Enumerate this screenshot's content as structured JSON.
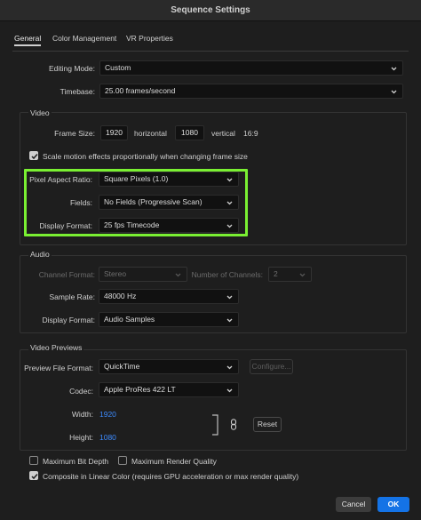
{
  "window": {
    "title": "Sequence Settings"
  },
  "tabs": [
    {
      "label": "General",
      "active": true
    },
    {
      "label": "Color Management",
      "active": false
    },
    {
      "label": "VR Properties",
      "active": false
    }
  ],
  "general": {
    "editing_mode": {
      "label": "Editing Mode:",
      "value": "Custom"
    },
    "timebase": {
      "label": "Timebase:",
      "value": "25.00  frames/second"
    }
  },
  "video": {
    "title": "Video",
    "frame_size": {
      "label": "Frame Size:",
      "width": "1920",
      "horizontal": "horizontal",
      "height": "1080",
      "vertical": "vertical",
      "aspect": "16:9"
    },
    "scale_motion": {
      "label": "Scale motion effects proportionally when changing frame size",
      "checked": true
    },
    "pixel_aspect": {
      "label": "Pixel Aspect Ratio:",
      "value": "Square Pixels (1.0)"
    },
    "fields": {
      "label": "Fields:",
      "value": "No Fields (Progressive Scan)"
    },
    "display_format": {
      "label": "Display Format:",
      "value": "25 fps Timecode"
    },
    "highlight_color": "#7af032"
  },
  "audio": {
    "title": "Audio",
    "channel_format": {
      "label": "Channel Format:",
      "value": "Stereo"
    },
    "num_channels": {
      "label": "Number of Channels:",
      "value": "2"
    },
    "sample_rate": {
      "label": "Sample Rate:",
      "value": "48000 Hz"
    },
    "display_format": {
      "label": "Display Format:",
      "value": "Audio Samples"
    }
  },
  "previews": {
    "title": "Video Previews",
    "file_format": {
      "label": "Preview File Format:",
      "value": "QuickTime"
    },
    "configure_label": "Configure...",
    "codec": {
      "label": "Codec:",
      "value": "Apple ProRes 422 LT"
    },
    "width": {
      "label": "Width:",
      "value": "1920"
    },
    "height": {
      "label": "Height:",
      "value": "1080"
    },
    "reset_label": "Reset",
    "link_icon": "chain-link-icon"
  },
  "options": {
    "max_bit_depth": {
      "label": "Maximum Bit Depth",
      "checked": false
    },
    "max_render_quality": {
      "label": "Maximum Render Quality",
      "checked": false
    },
    "linear_color": {
      "label": "Composite in Linear Color (requires GPU acceleration or max render quality)",
      "checked": true
    }
  },
  "footer": {
    "cancel_label": "Cancel",
    "ok_label": "OK",
    "ok_color": "#1473e6"
  }
}
